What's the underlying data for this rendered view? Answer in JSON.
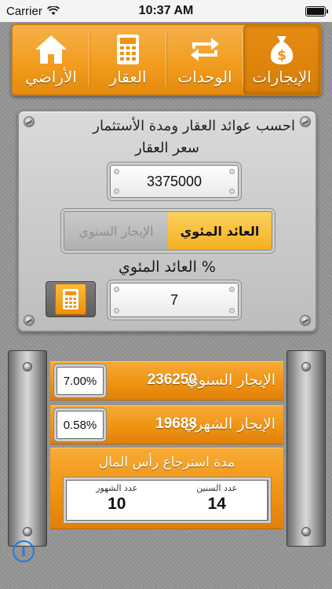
{
  "status": {
    "carrier": "Carrier",
    "time": "10:37 AM"
  },
  "nav": {
    "items": [
      {
        "label": "الإيجارات",
        "icon": "money-bag-icon",
        "active": true
      },
      {
        "label": "الوحدات",
        "icon": "swap-arrows-icon",
        "active": false
      },
      {
        "label": "العقار",
        "icon": "calculator-icon",
        "active": false
      },
      {
        "label": "الأراضي",
        "icon": "home-icon",
        "active": false
      }
    ]
  },
  "form": {
    "title": "احسب عوائد العقار ومدة الأستثمار",
    "price_label": "سعر العقار",
    "price_value": "3375000",
    "segment": {
      "option_yield": "العائد المئوي",
      "option_rent": "الإيجار السنوي",
      "selected": "العائد المئوي"
    },
    "percent_label": "العائد المئوي %",
    "percent_value": "7"
  },
  "results": {
    "annual": {
      "label": "الإيجار السنوي",
      "value": "236250",
      "percent": "7.00%"
    },
    "monthly": {
      "label": "الإيجار الشهري",
      "value": "19688",
      "percent": "0.58%"
    },
    "payback": {
      "title": "مدة استرجاع رأس المال",
      "years_label": "عدد السنين",
      "years_value": "14",
      "months_label": "عدد الشهور",
      "months_value": "10"
    }
  },
  "colors": {
    "accent": "#f29b1c",
    "info": "#1f7ae0"
  }
}
